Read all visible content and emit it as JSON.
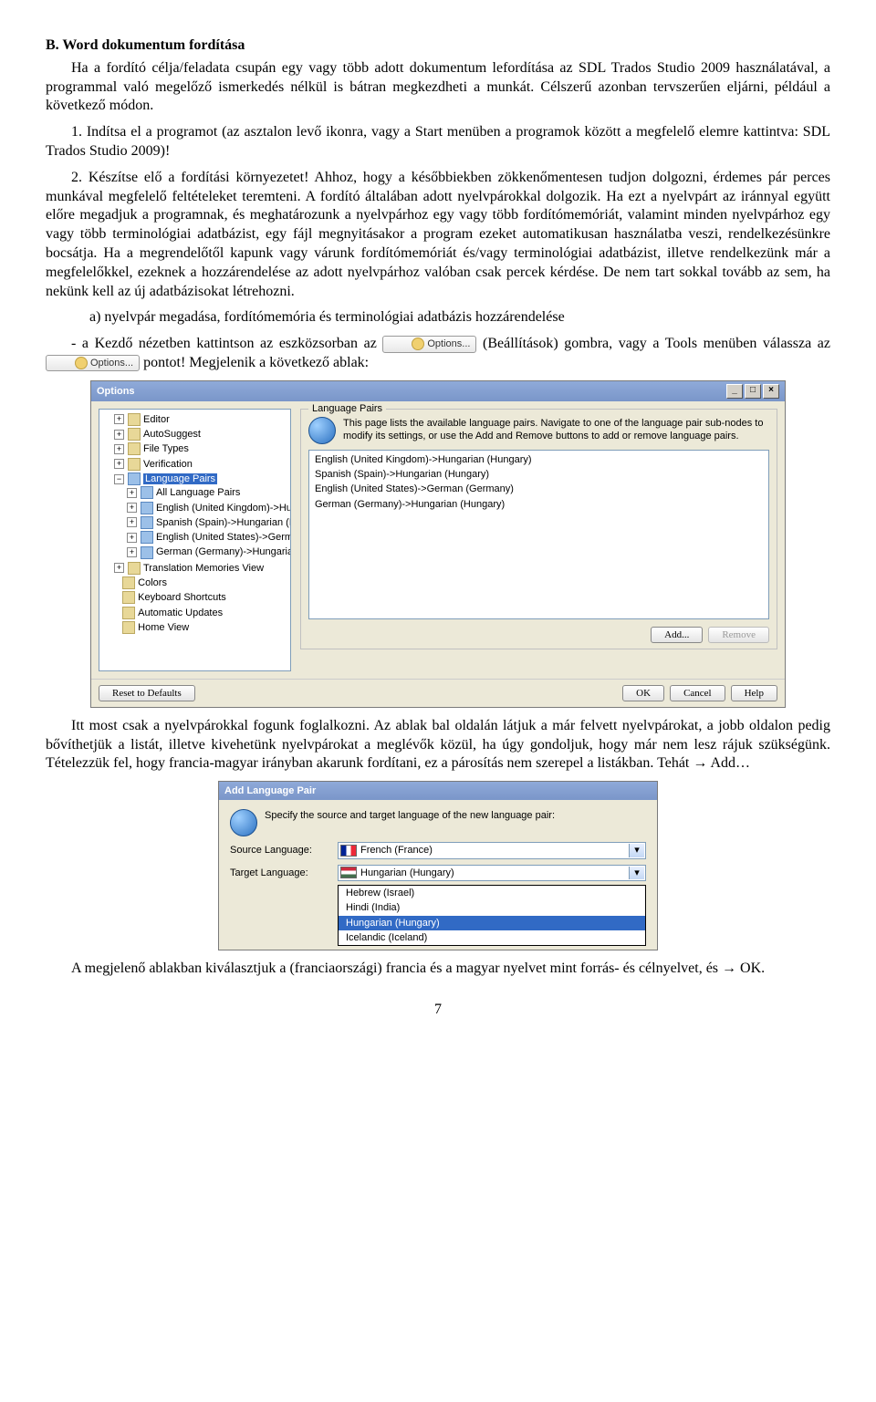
{
  "heading": "B. Word dokumentum fordítása",
  "para1": "Ha a fordító célja/feladata csupán egy vagy több adott dokumentum lefordítása az SDL Trados Studio 2009 használatával, a programmal való megelőző ismerkedés nélkül is bátran megkezdheti a munkát. Célszerű azonban tervszerűen eljárni, például a következő módon.",
  "step1": "1. Indítsa el a programot (az asztalon levő ikonra, vagy a Start menüben a programok között a megfelelő elemre kattintva: SDL Trados Studio 2009)!",
  "step2": "2. Készítse elő a fordítási környezetet! Ahhoz, hogy a későbbiekben zökkenőmentesen tudjon dolgozni, érdemes pár perces munkával megfelelő feltételeket teremteni. A fordító általában adott nyelvpárokkal dolgozik. Ha ezt a nyelvpárt az iránnyal együtt előre megadjuk a programnak, és meghatározunk a nyelvpárhoz egy vagy több fordítómemóriát, valamint minden nyelvpárhoz egy vagy több terminológiai adatbázist, egy fájl megnyitásakor a program ezeket automatikusan használatba veszi, rendelkezésünkre bocsátja. Ha a megrendelőtől kapunk vagy várunk fordítómemóriát és/vagy terminológiai adatbázist, illetve rendelkezünk már a megfelelőkkel, ezeknek a hozzárendelése az adott nyelvpárhoz valóban csak percek kérdése. De nem tart sokkal tovább az sem, ha nekünk kell az új adatbázisokat létrehozni.",
  "step_a": "a) nyelvpár megadása, fordítómemória és terminológiai adatbázis hozzárendelése",
  "step_dash_a": "- a Kezdő nézetben kattintson az eszközsorban az ",
  "step_dash_b": " (Beállítások) gombra, vagy a Tools menüben válassza az ",
  "step_dash_c": " pontot! Megjelenik a következő ablak:",
  "btn_options": "Options...",
  "options_dlg": {
    "title": "Options",
    "tree": {
      "editor": "Editor",
      "autosuggest": "AutoSuggest",
      "filetypes": "File Types",
      "verification": "Verification",
      "langpairs": "Language Pairs",
      "all": "All Language Pairs",
      "en_hu": "English (United Kingdom)->Hungar",
      "es_hu": "Spanish (Spain)->Hungarian (Hung",
      "enus_de": "English (United States)->German (",
      "de_hu": "German (Germany)->Hungarian (H",
      "tmview": "Translation Memories View",
      "colors": "Colors",
      "shortcuts": "Keyboard Shortcuts",
      "updates": "Automatic Updates",
      "home": "Home View"
    },
    "group_title": "Language Pairs",
    "info": "This page lists the available language pairs. Navigate to one of the language pair sub-nodes to modify its settings, or use the Add and Remove buttons to add or remove language pairs.",
    "list": [
      "English (United Kingdom)->Hungarian (Hungary)",
      "Spanish (Spain)->Hungarian (Hungary)",
      "English (United States)->German (Germany)",
      "German (Germany)->Hungarian (Hungary)"
    ],
    "add": "Add...",
    "remove": "Remove",
    "reset": "Reset to Defaults",
    "ok": "OK",
    "cancel": "Cancel",
    "help": "Help"
  },
  "para_after_dlg": "Itt most csak a nyelvpárokkal fogunk foglalkozni. Az ablak bal oldalán látjuk a már felvett nyelvpárokat, a jobb oldalon pedig bővíthetjük a listát, illetve kivehetünk nyelvpárokat a meglévők közül, ha úgy gondoljuk, hogy már nem lesz rájuk szükségünk. Tételezzük fel, hogy francia-magyar irányban akarunk fordítani, ez a párosítás nem szerepel a listákban. Tehát → Add…",
  "add_dlg": {
    "title": "Add Language Pair",
    "info": "Specify the source and target language of the new language pair:",
    "src_label": "Source Language:",
    "tgt_label": "Target Language:",
    "src_value": "French (France)",
    "tgt_value": "Hungarian (Hungary)",
    "dd": {
      "he": "Hebrew (Israel)",
      "hi": "Hindi (India)",
      "hu": "Hungarian (Hungary)",
      "is": "Icelandic (Iceland)"
    }
  },
  "para_last": "A megjelenő ablakban kiválasztjuk a (franciaországi) francia és a magyar nyelvet mint forrás- és célnyelvet, és → OK.",
  "pagenum": "7"
}
